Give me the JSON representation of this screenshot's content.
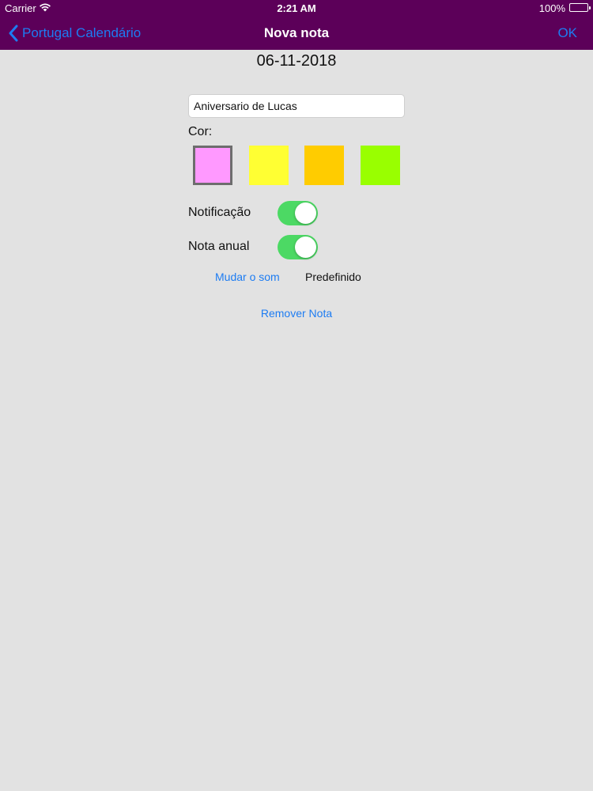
{
  "status_bar": {
    "carrier": "Carrier",
    "time": "2:21 AM",
    "battery": "100%"
  },
  "nav": {
    "back_label": "Portugal Calendário",
    "title": "Nova nota",
    "ok_label": "OK"
  },
  "note": {
    "date": "06-11-2018",
    "text_value": "Aniversario de Lucas",
    "color_label": "Cor:",
    "colors": [
      "#ff99ff",
      "#ffff33",
      "#ffcc00",
      "#99ff00"
    ],
    "selected_color_index": 0,
    "notification_label": "Notificação",
    "notification_on": true,
    "annual_label": "Nota anual",
    "annual_on": true,
    "sound_link": "Mudar o som",
    "sound_value": "Predefinido",
    "remove_label": "Remover Nota"
  },
  "theme": {
    "navbar": "#5c0059",
    "accent": "#1d7cf2",
    "toggle_on": "#4cd964",
    "background": "#e2e2e2"
  }
}
